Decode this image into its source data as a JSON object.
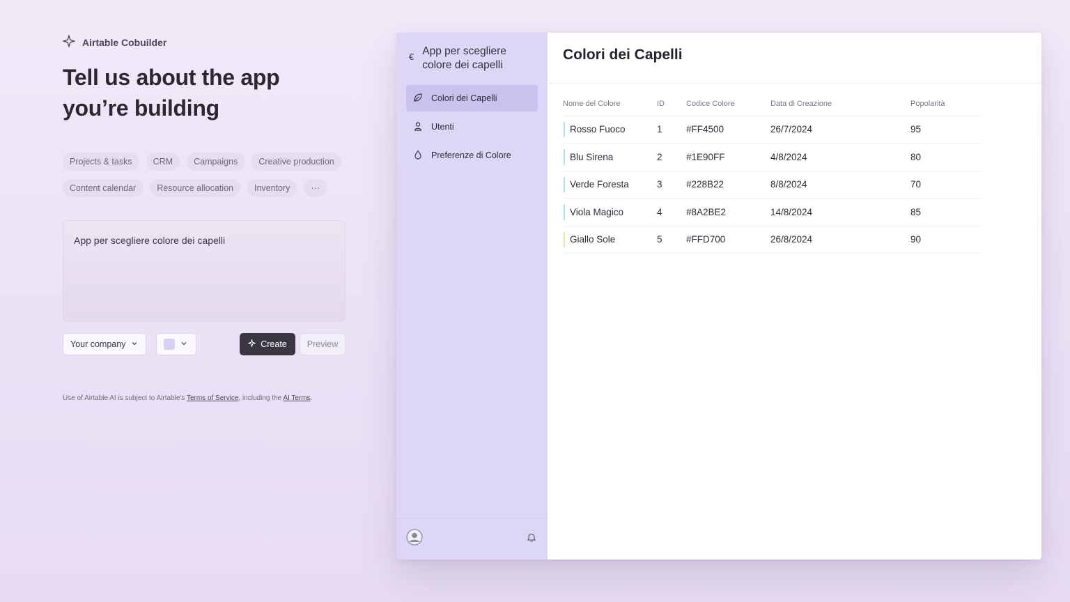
{
  "brand": {
    "name": "Airtable Cobuilder"
  },
  "headline": "Tell us about the app you’re building",
  "chips": [
    "Projects & tasks",
    "CRM",
    "Campaigns",
    "Creative production",
    "Content calendar",
    "Resource allocation",
    "Inventory",
    "···"
  ],
  "prompt": {
    "value": "App per scegliere colore dei capelli"
  },
  "controls": {
    "company_select": "Your company",
    "color_select_swatch": "#d8d1f5",
    "create_label": "Create",
    "preview_label": "Preview"
  },
  "terms": {
    "text_before": "Use of Airtable AI is subject to Airtable's ",
    "link1": "Terms of Service",
    "text_middle": ", including the ",
    "link2": "AI Terms",
    "text_after": "."
  },
  "app": {
    "currency_icon": "€",
    "title": "App per scegliere colore dei capelli",
    "nav": [
      {
        "label": "Colori dei Capelli",
        "icon": "leaf-icon",
        "active": true
      },
      {
        "label": "Utenti",
        "icon": "user-icon",
        "active": false
      },
      {
        "label": "Preferenze di Colore",
        "icon": "drop-icon",
        "active": false
      }
    ],
    "main_title": "Colori dei Capelli",
    "table": {
      "columns": [
        "Nome del Colore",
        "ID",
        "Codice Colore",
        "Data di Creazione",
        "Popolarità"
      ],
      "rows": [
        {
          "name": "Rosso Fuoco",
          "id": "1",
          "code": "#FF4500",
          "date": "26/7/2024",
          "pop": "95",
          "accent": "#a9ddef"
        },
        {
          "name": "Blu Sirena",
          "id": "2",
          "code": "#1E90FF",
          "date": "4/8/2024",
          "pop": "80",
          "accent": "#a9ddef"
        },
        {
          "name": "Verde Foresta",
          "id": "3",
          "code": "#228B22",
          "date": "8/8/2024",
          "pop": "70",
          "accent": "#a9ddef"
        },
        {
          "name": "Viola Magico",
          "id": "4",
          "code": "#8A2BE2",
          "date": "14/8/2024",
          "pop": "85",
          "accent": "#a9ddef"
        },
        {
          "name": "Giallo Sole",
          "id": "5",
          "code": "#FFD700",
          "date": "26/8/2024",
          "pop": "90",
          "accent": "#f5dca0"
        }
      ]
    }
  }
}
